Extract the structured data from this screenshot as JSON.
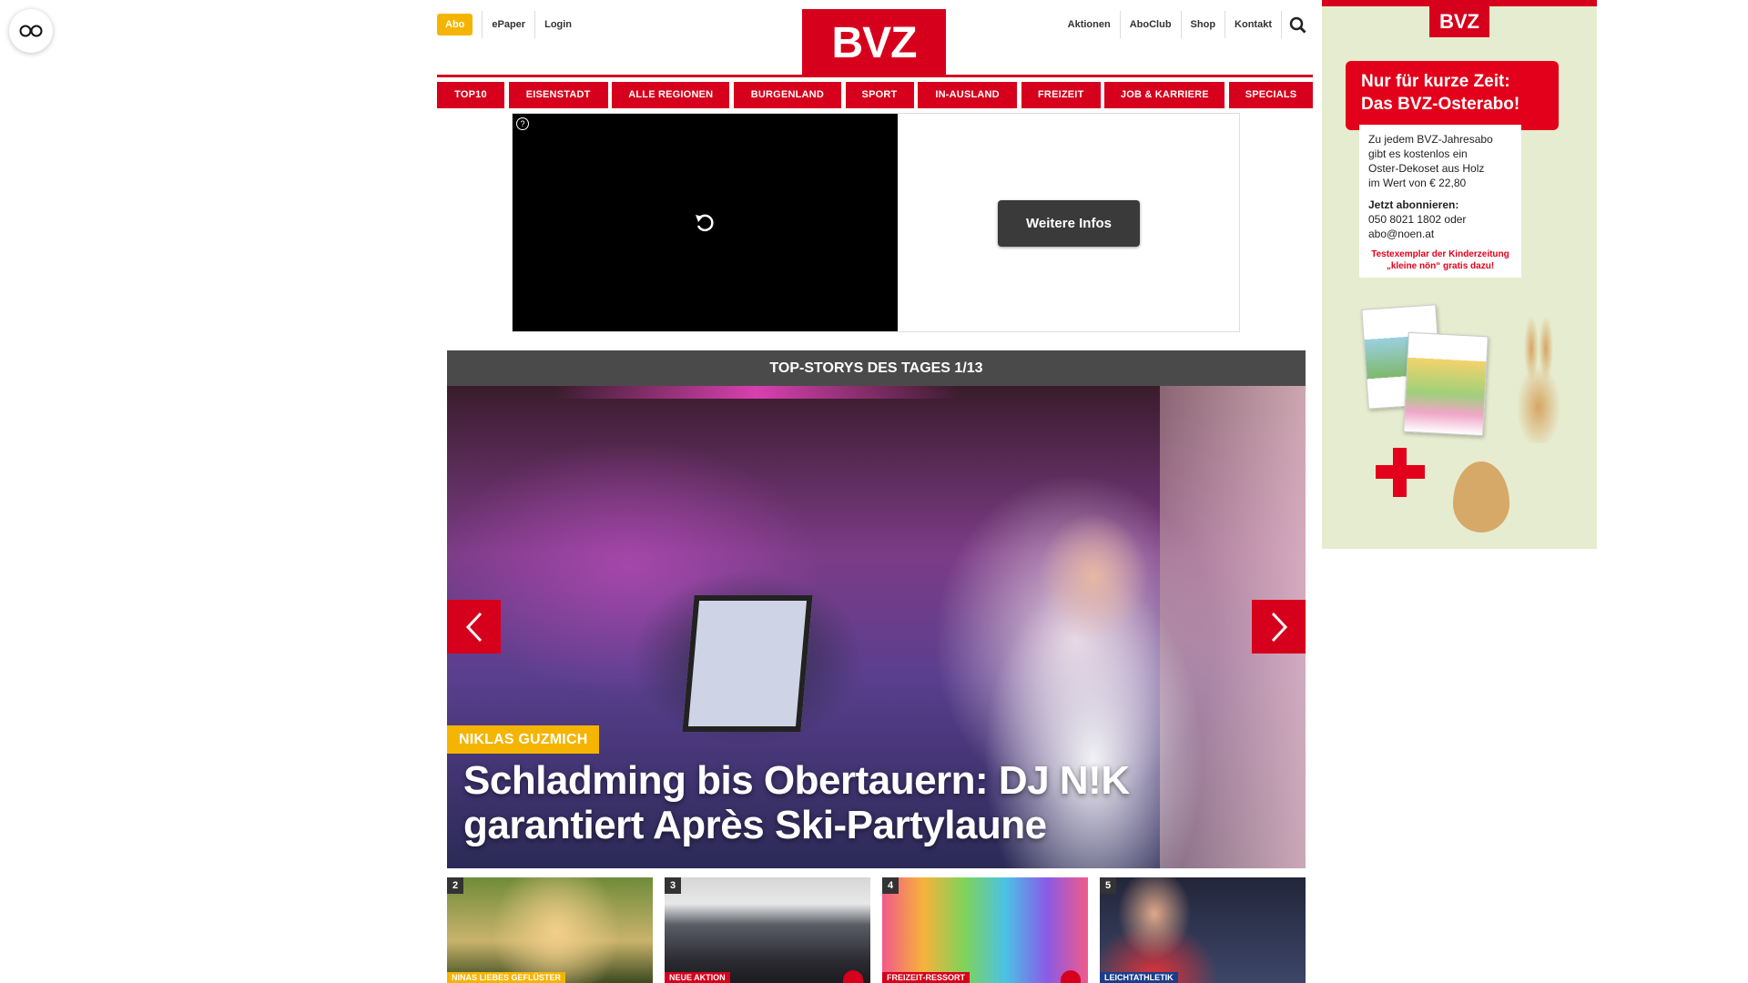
{
  "header": {
    "abo": "Abo",
    "epaper": "ePaper",
    "login": "Login",
    "logo": "BVZ",
    "meta_right": [
      "Aktionen",
      "AboClub",
      "Shop",
      "Kontakt"
    ]
  },
  "nav": [
    "TOP10",
    "EISENSTADT",
    "ALLE REGIONEN",
    "BURGENLAND",
    "SPORT",
    "IN-AUSLAND",
    "FREIZEIT",
    "JOB & KARRIERE",
    "SPECIALS"
  ],
  "video_ad": {
    "button": "Weitere Infos",
    "info_glyph": "?"
  },
  "top_stories": {
    "heading": "TOP-STORYS DES TAGES 1/13",
    "hero": {
      "tag": "NIKLAS GUZMICH",
      "title": "Schladming bis Obertauern: DJ N!K garantiert Après Ski-Partylaune"
    },
    "thumbs": [
      {
        "num": "2",
        "tag": "NINAS LIEBES GEFLÜSTER",
        "tag_color": "#f5b400",
        "camera": false
      },
      {
        "num": "3",
        "tag": "NEUE AKTION",
        "tag_color": "#d6001c",
        "camera": true
      },
      {
        "num": "4",
        "tag": "FREIZEIT-RESSORT",
        "tag_color": "#d6001c",
        "camera": true
      },
      {
        "num": "5",
        "tag": "LEICHTATHLETIK",
        "tag_color": "#1b3e8c",
        "camera": false
      }
    ]
  },
  "side_ad": {
    "logo": "BVZ",
    "headline_1": "Nur für kurze Zeit:",
    "headline_2": "Das BVZ-Osterabo!",
    "body_1": "Zu jedem BVZ-Jahresabo",
    "body_2": "gibt es kostenlos ein",
    "body_3": "Oster-Dekoset aus Holz",
    "body_4": "im Wert von € 22,80",
    "cta": "Jetzt abonnieren:",
    "contact_1": "050 8021 1802 oder",
    "contact_2": "abo@noen.at",
    "promo_1": "Testexemplar der Kinderzeitung",
    "promo_2": "„kleine nön“ gratis dazu!"
  },
  "colors": {
    "brand_red": "#d6001c",
    "accent_yellow": "#f5b400"
  }
}
